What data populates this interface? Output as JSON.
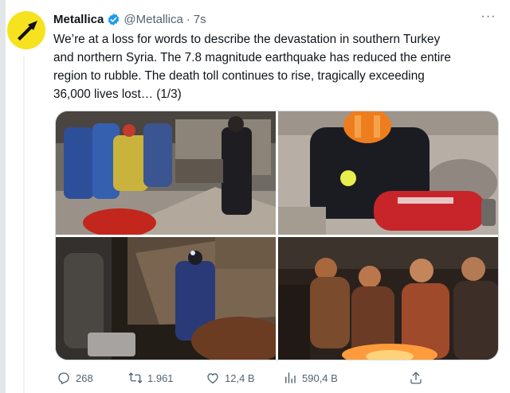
{
  "tweet": {
    "author_name": "Metallica",
    "handle": "@Metallica",
    "separator": "·",
    "time": "7s",
    "more_label": "···",
    "text_lines": [
      "We’re at a loss for words to describe the devastation in southern Turkey",
      "and northern Syria. The 7.8 magnitude earthquake has reduced the entire",
      "region to rubble. The death toll continues to rise, tragically exceeding",
      "36,000 lives lost… (1/3)"
    ]
  },
  "media": {
    "photos": [
      {
        "icon": "rescue-workers-rubble-photo"
      },
      {
        "icon": "rescuer-orange-helmet-photo"
      },
      {
        "icon": "night-rescue-headlamp-photo"
      },
      {
        "icon": "people-around-fire-photo"
      }
    ]
  },
  "actions": {
    "replies": "268",
    "retweets": "1.961",
    "likes": "12,4 B",
    "views": "590,4 B"
  },
  "colors": {
    "avatar_bg": "#f7e21f",
    "verified": "#1d9bf0",
    "secondary_text": "#536471"
  }
}
